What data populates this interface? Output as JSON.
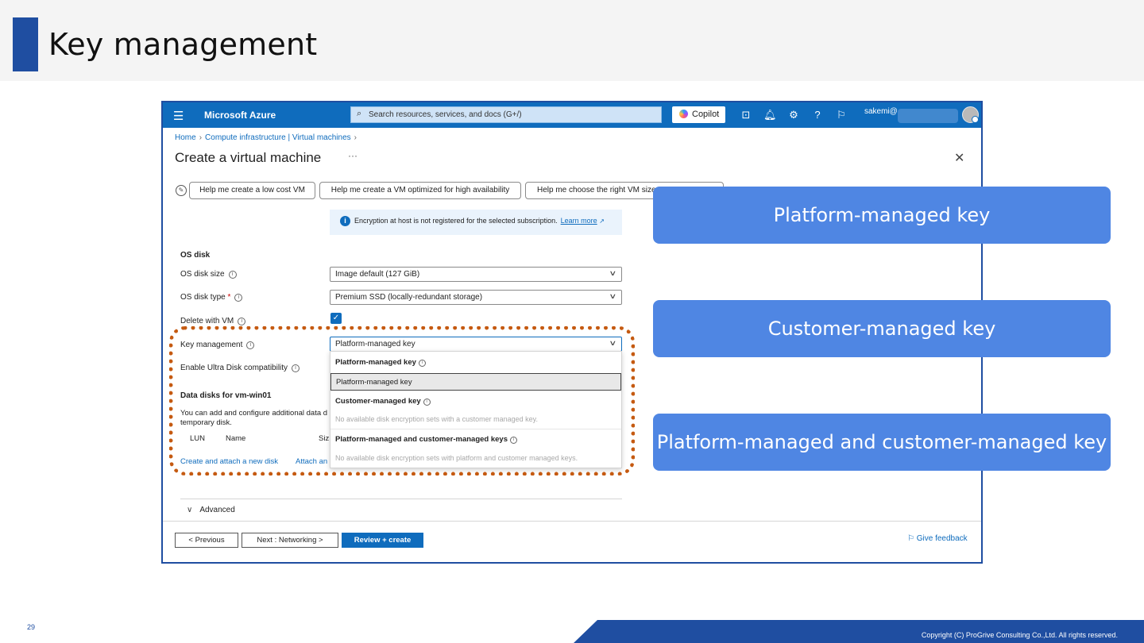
{
  "slide": {
    "title": "Key management",
    "page_number": "29",
    "copyright": "Copyright (C) ProGrive Consulting Co.,Ltd. All rights reserved."
  },
  "azure": {
    "brand": "Microsoft Azure",
    "search_placeholder": "Search resources, services, and docs (G+/)",
    "copilot_label": "Copilot",
    "user": "sakemi@",
    "toolbar_icons": [
      "cloud-shell-icon",
      "bell-icon",
      "gear-icon",
      "help-icon",
      "feedback-icon"
    ]
  },
  "breadcrumb": {
    "home": "Home",
    "compute": "Compute infrastructure | Virtual machines"
  },
  "page": {
    "title": "Create a virtual machine",
    "more": "···",
    "close": "✕"
  },
  "help_buttons": [
    "Help me create a low cost VM",
    "Help me create a VM optimized for high availability",
    "Help me choose the right VM size"
  ],
  "info": {
    "text": "Encryption at host is not registered for the selected subscription.",
    "link": "Learn more"
  },
  "os_disk": {
    "section": "OS disk",
    "size_label": "OS disk size",
    "size_value": "Image default (127 GiB)",
    "type_label": "OS disk type",
    "type_required": "*",
    "type_value": "Premium SSD (locally-redundant storage)",
    "delete_label": "Delete with VM",
    "delete_checked": true,
    "key_label": "Key management",
    "key_value": "Platform-managed key",
    "ultra_label": "Enable Ultra Disk compatibility"
  },
  "key_dropdown": {
    "group1_head": "Platform-managed key",
    "group1_option": "Platform-managed key",
    "group2_head": "Customer-managed key",
    "group2_disabled": "No available disk encryption sets with a customer managed key.",
    "group3_head": "Platform-managed and customer-managed keys",
    "group3_disabled": "No available disk encryption sets with platform and customer managed keys."
  },
  "data_disks": {
    "title": "Data disks for vm-win01",
    "desc1": "You can add and configure additional data d",
    "desc2": "temporary disk.",
    "col_lun": "LUN",
    "col_name": "Name",
    "col_size": "Siz",
    "link_create": "Create and attach a new disk",
    "link_attach": "Attach an"
  },
  "advanced": "Advanced",
  "footer": {
    "previous": "< Previous",
    "next": "Next : Networking >",
    "review": "Review + create",
    "feedback": "Give feedback"
  },
  "callouts": [
    "Platform-managed key",
    "Customer-managed key",
    "Platform-managed and customer-managed key"
  ],
  "colors": {
    "azure_blue": "#0f6cbd",
    "slide_accent": "#1f4ea1",
    "callout": "#4f86e3",
    "highlight": "#c55a11"
  }
}
